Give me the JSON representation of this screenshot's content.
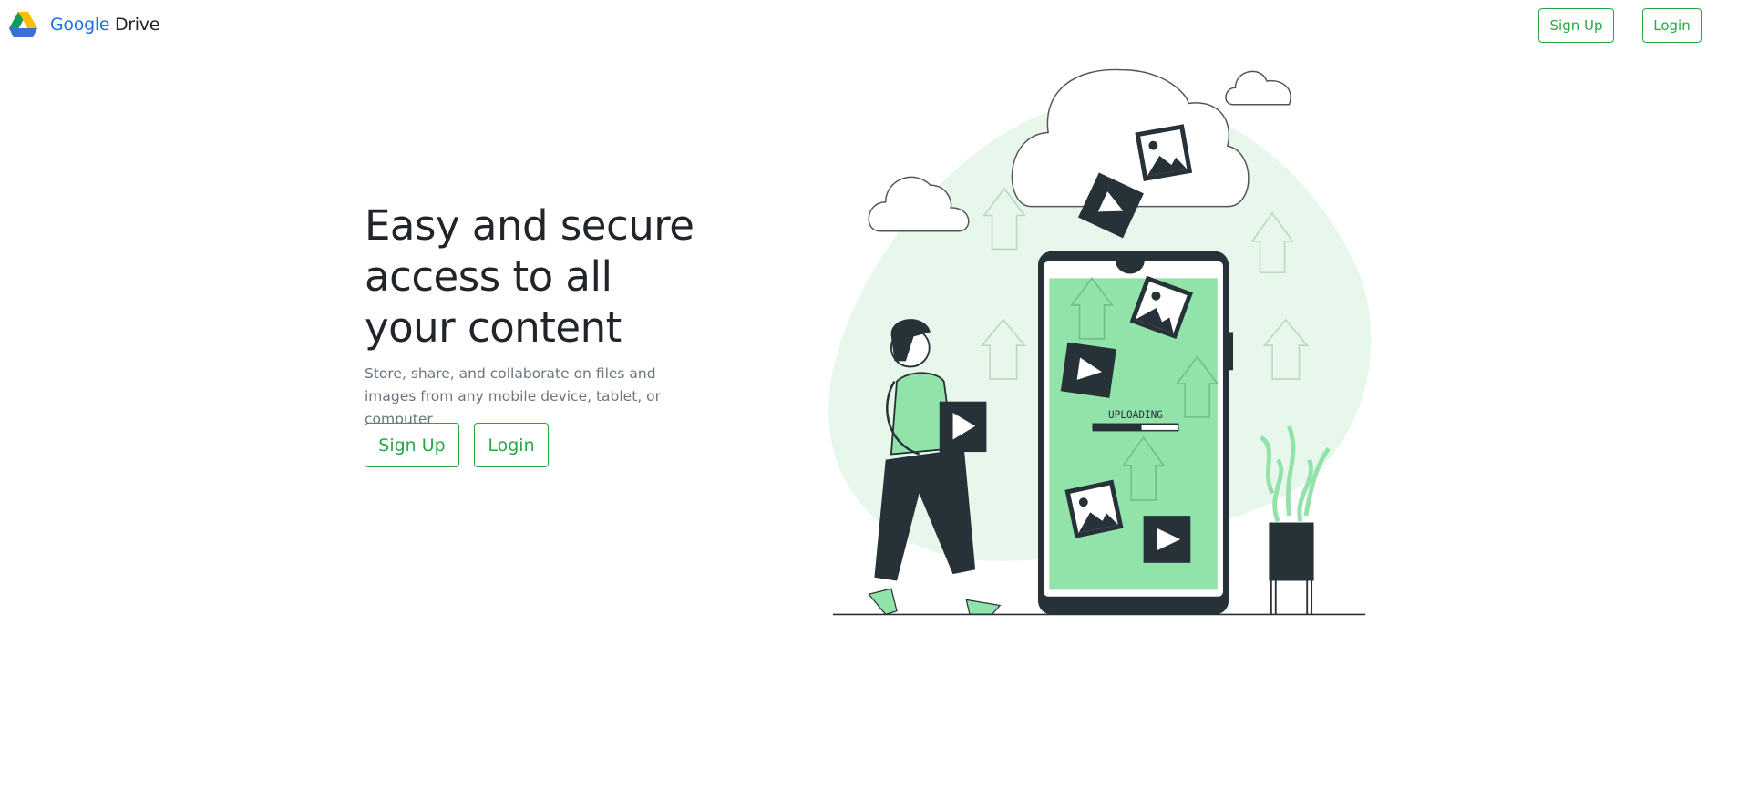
{
  "navbar": {
    "brand_first": "Google",
    "brand_second": "Drive",
    "logo_icon": "google-drive-logo",
    "signup_label": "Sign Up",
    "login_label": "Login"
  },
  "hero": {
    "heading": "Easy and secure access to all your content",
    "description": "Store, share, and collaborate on files and images from any mobile device, tablet, or computer",
    "signup_label": "Sign Up",
    "login_label": "Login"
  },
  "illustration": {
    "upload_label": "UPLOADING",
    "upload_progress": 0.57
  },
  "colors": {
    "accent": "#28a745",
    "brand_blue": "#1a73e8",
    "illustration_green": "#92e3a9",
    "dark": "#263238"
  }
}
